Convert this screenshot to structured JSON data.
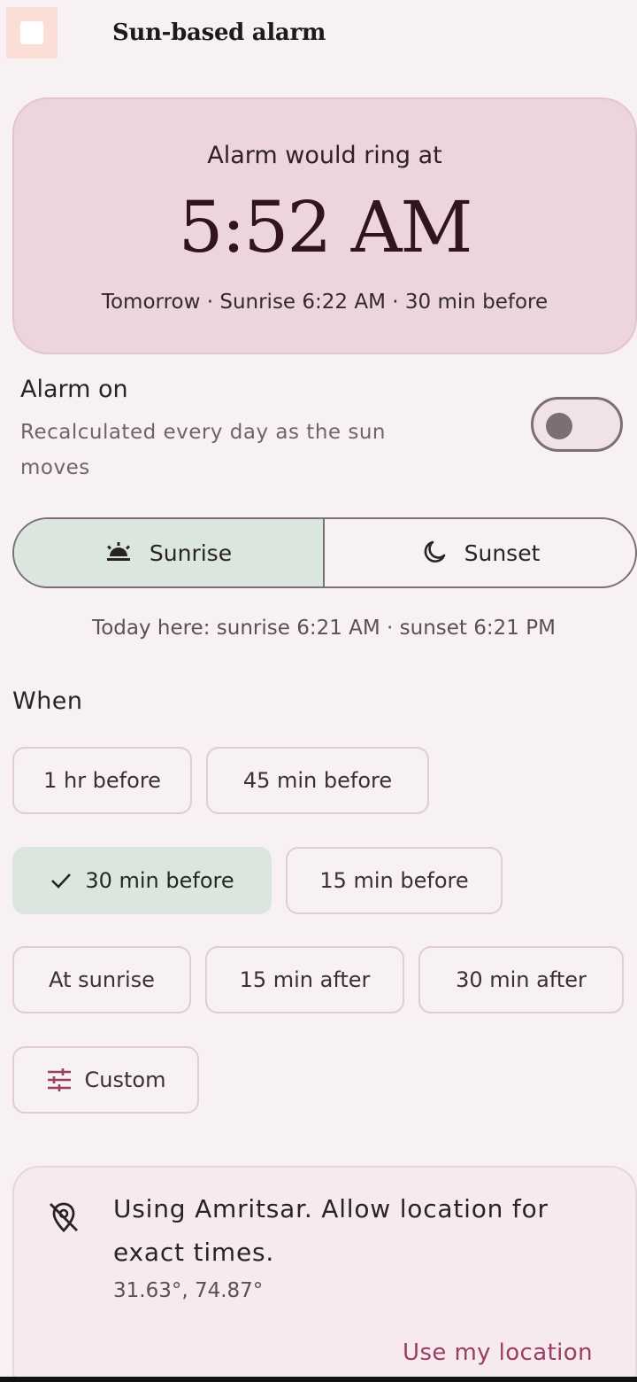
{
  "app": {
    "title": "Sun-based alarm",
    "icon": "app-icon"
  },
  "hero": {
    "label": "Alarm would ring at",
    "time": "5:52 AM",
    "sub": "Tomorrow · Sunrise 6:22 AM · 30 min before"
  },
  "alarm": {
    "title": "Alarm on",
    "desc": "Recalculated every day as the sun moves",
    "enabled": false
  },
  "mode": {
    "options": [
      {
        "label": "Sunrise",
        "icon": "sunrise-icon",
        "selected": true
      },
      {
        "label": "Sunset",
        "icon": "moon-icon",
        "selected": false
      }
    ]
  },
  "today": "Today here: sunrise 6:21 AM · sunset 6:21 PM",
  "when": {
    "label": "When",
    "chips": [
      {
        "label": "1 hr before"
      },
      {
        "label": "45 min before"
      },
      {
        "label": "30 min before",
        "selected": true,
        "icon": "check-icon"
      },
      {
        "label": "15 min before"
      },
      {
        "label": "At sunrise"
      },
      {
        "label": "15 min after"
      },
      {
        "label": "30 min after"
      },
      {
        "label": "Custom",
        "icon": "sliders-icon"
      }
    ]
  },
  "location": {
    "icon": "location-off-icon",
    "text": "Using Amritsar. Allow location for exact times.",
    "coords": "31.63°, 74.87°",
    "action": "Use my location"
  },
  "colors": {
    "background": "#f8f1f3",
    "hero": "#ecd5dc",
    "selected": "#dbe6df",
    "accent": "#9a3e63"
  }
}
